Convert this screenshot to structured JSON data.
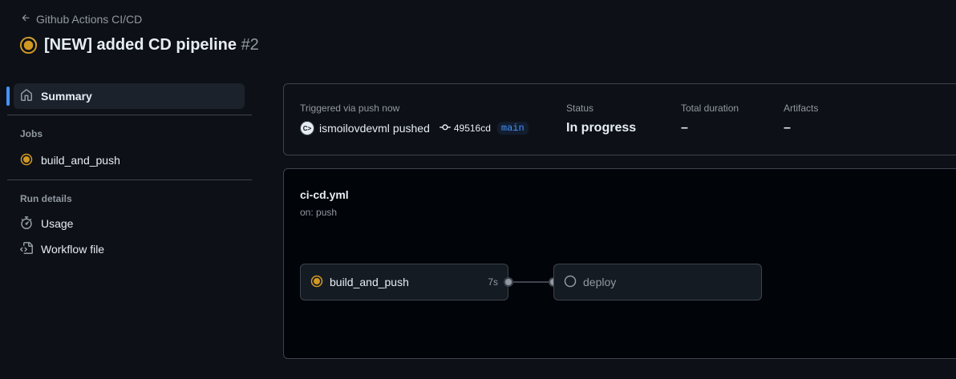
{
  "breadcrumb": {
    "back_label": "Github Actions CI/CD"
  },
  "run": {
    "title": "[NEW] added CD pipeline",
    "number": "#2",
    "status_color": "#d29922"
  },
  "sidebar": {
    "summary_label": "Summary",
    "jobs_heading": "Jobs",
    "jobs": [
      {
        "label": "build_and_push",
        "status": "in_progress"
      }
    ],
    "run_details_heading": "Run details",
    "usage_label": "Usage",
    "workflow_file_label": "Workflow file"
  },
  "summary": {
    "trigger_label": "Triggered via push now",
    "actor": "ismoilovdevml",
    "action": "pushed",
    "commit": "49516cd",
    "branch": "main",
    "status_label": "Status",
    "status_value": "In progress",
    "duration_label": "Total duration",
    "duration_value": "–",
    "artifacts_label": "Artifacts",
    "artifacts_value": "–"
  },
  "workflow": {
    "file": "ci-cd.yml",
    "trigger": "on: push",
    "jobs": [
      {
        "name": "build_and_push",
        "duration": "7s",
        "status": "in_progress"
      },
      {
        "name": "deploy",
        "duration": "",
        "status": "queued"
      }
    ]
  },
  "colors": {
    "accent_blue": "#4493f8",
    "in_progress_yellow": "#d29922",
    "background": "#0d1117",
    "border": "#3d444d"
  }
}
